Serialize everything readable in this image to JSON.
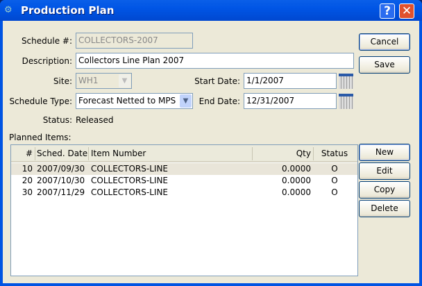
{
  "window": {
    "title": "Production Plan",
    "help": "?",
    "close": "✕"
  },
  "form": {
    "schedule_label": "Schedule #:",
    "schedule_value": "COLLECTORS-2007",
    "description_label": "Description:",
    "description_value": "Collectors Line Plan 2007",
    "site_label": "Site:",
    "site_value": "WH1",
    "start_label": "Start Date:",
    "start_value": "1/1/2007",
    "type_label": "Schedule Type:",
    "type_value": "Forecast Netted to MPS",
    "end_label": "End Date:",
    "end_value": "12/31/2007",
    "status_label": "Status:",
    "status_value": "Released",
    "planned_label": "Planned Items:"
  },
  "buttons": {
    "cancel": "Cancel",
    "save": "Save",
    "new": "New",
    "edit": "Edit",
    "copy": "Copy",
    "delete": "Delete"
  },
  "table": {
    "columns": [
      "#",
      "Sched. Date",
      "Item Number",
      "Qty",
      "Status"
    ],
    "rows": [
      {
        "num": "10",
        "date": "2007/09/30",
        "item": "COLLECTORS-LINE",
        "qty": "0.0000",
        "status": "O"
      },
      {
        "num": "20",
        "date": "2007/10/30",
        "item": "COLLECTORS-LINE",
        "qty": "0.0000",
        "status": "O"
      },
      {
        "num": "30",
        "date": "2007/11/29",
        "item": "COLLECTORS-LINE",
        "qty": "0.0000",
        "status": "O"
      }
    ]
  },
  "colors": {
    "titlebar": "#0054e3",
    "face": "#ece9d8",
    "selected_row": "#e9e5d9"
  }
}
